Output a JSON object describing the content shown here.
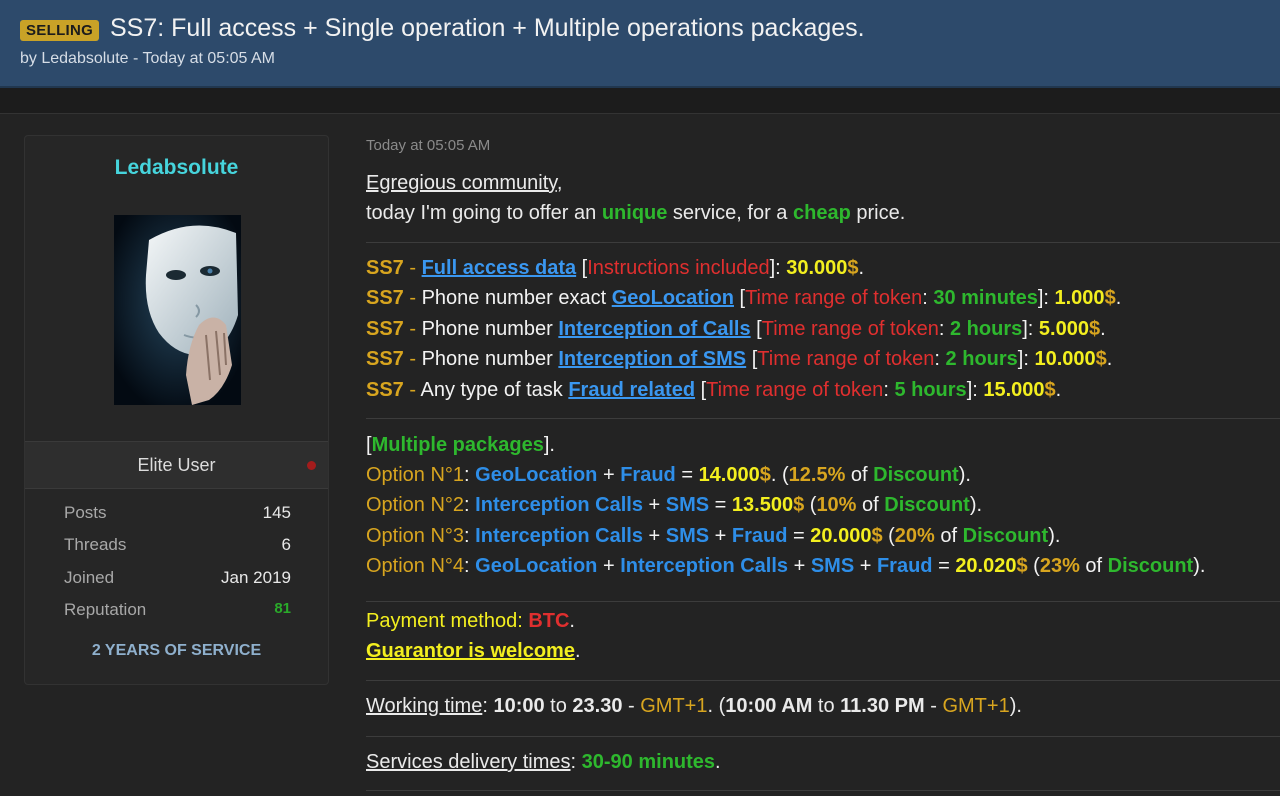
{
  "thread": {
    "badge": "SELLING",
    "title": "SS7: Full access + Single operation + Multiple operations packages.",
    "byline": "by Ledabsolute - Today at 05:05 AM"
  },
  "user": {
    "name": "Ledabsolute",
    "rank": "Elite User",
    "stats": [
      {
        "label": "Posts",
        "value": "145"
      },
      {
        "label": "Threads",
        "value": "6"
      },
      {
        "label": "Joined",
        "value": "Jan 2019"
      },
      {
        "label": "Reputation",
        "value": "81"
      }
    ],
    "service": "2 YEARS OF SERVICE"
  },
  "post": {
    "date": "Today at 05:05 AM",
    "intro": {
      "greeting": "Egregious community",
      "comma": ",",
      "l2_a": "today I'm going to offer an ",
      "l2_unique": "unique",
      "l2_b": " service, for a ",
      "l2_cheap": "cheap",
      "l2_c": " price."
    },
    "offers": [
      {
        "ss7": "SS7",
        "dash": " - ",
        "pre": "",
        "link": "Full access data",
        "br_open": " [",
        "token_label": "Instructions included",
        "colon": "",
        "token_value": "",
        "br_close": "]: ",
        "price": "30.000",
        "dollar": "$",
        "end": "."
      },
      {
        "ss7": "SS7",
        "dash": " - ",
        "pre": "Phone number exact ",
        "link": "GeoLocation",
        "br_open": " [",
        "token_label": "Time range of token",
        "colon": ": ",
        "token_value": "30 minutes",
        "br_close": "]: ",
        "price": "1.000",
        "dollar": "$",
        "end": "."
      },
      {
        "ss7": "SS7",
        "dash": " - ",
        "pre": "Phone number ",
        "link": "Interception of Calls",
        "br_open": " [",
        "token_label": "Time range of token",
        "colon": ": ",
        "token_value": "2 hours",
        "br_close": "]: ",
        "price": "5.000",
        "dollar": "$",
        "end": "."
      },
      {
        "ss7": "SS7",
        "dash": " - ",
        "pre": "Phone number ",
        "link": "Interception of SMS",
        "br_open": " [",
        "token_label": "Time range of token",
        "colon": ": ",
        "token_value": "2 hours",
        "br_close": "]: ",
        "price": "10.000",
        "dollar": "$",
        "end": "."
      },
      {
        "ss7": "SS7",
        "dash": " - ",
        "pre": "Any type of task ",
        "link": "Fraud related",
        "br_open": " [",
        "token_label": "Time range of token",
        "colon": ": ",
        "token_value": "5 hours",
        "br_close": "]: ",
        "price": "15.000",
        "dollar": "$",
        "end": "."
      }
    ],
    "packages": {
      "br_open": "[",
      "heading": "Multiple packages",
      "br_close": "].",
      "options": [
        {
          "label": "Option N°1",
          "sep": ": ",
          "items": [
            {
              "t": "GeoLocation",
              "c": "blue"
            },
            {
              "t": " + ",
              "c": "white"
            },
            {
              "t": "Fraud",
              "c": "blue"
            }
          ],
          "eq": " = ",
          "price": "14.000",
          "dollar": "$",
          "mid": ". (",
          "pct": "12.5%",
          "of": " of ",
          "disc": "Discount",
          "end": ")."
        },
        {
          "label": "Option N°2",
          "sep": ": ",
          "items": [
            {
              "t": "Interception Calls",
              "c": "blue"
            },
            {
              "t": " + ",
              "c": "white"
            },
            {
              "t": "SMS",
              "c": "blue"
            }
          ],
          "eq": " = ",
          "price": "13.500",
          "dollar": "$",
          "mid": " (",
          "pct": "10%",
          "of": " of ",
          "disc": "Discount",
          "end": ")."
        },
        {
          "label": "Option N°3",
          "sep": ": ",
          "items": [
            {
              "t": "Interception Calls",
              "c": "blue"
            },
            {
              "t": " + ",
              "c": "white"
            },
            {
              "t": "SMS",
              "c": "blue"
            },
            {
              "t": " + ",
              "c": "white"
            },
            {
              "t": "Fraud",
              "c": "blue"
            }
          ],
          "eq": " = ",
          "price": "20.000",
          "dollar": "$",
          "mid": " (",
          "pct": "20%",
          "of": " of ",
          "disc": "Discount",
          "end": ")."
        },
        {
          "label": "Option N°4",
          "sep": ": ",
          "items": [
            {
              "t": "GeoLocation",
              "c": "blue"
            },
            {
              "t": " + ",
              "c": "white"
            },
            {
              "t": "Interception Calls",
              "c": "blue"
            },
            {
              "t": " + ",
              "c": "white"
            },
            {
              "t": "SMS",
              "c": "blue"
            },
            {
              "t": " + ",
              "c": "white"
            },
            {
              "t": "Fraud",
              "c": "blue"
            }
          ],
          "eq": " = ",
          "price": "20.020",
          "dollar": "$",
          "mid": " (",
          "pct": "23%",
          "of": " of ",
          "disc": "Discount",
          "end": ")."
        }
      ]
    },
    "payment": {
      "label": "Payment method: ",
      "method": "BTC",
      "end": ".",
      "guarantor": "Guarantor is welcome",
      "guarantor_end": "."
    },
    "working": {
      "label": "Working time",
      "colon": ": ",
      "from": "10:00",
      "to_word": " to ",
      "to": "23.30",
      "dash": " - ",
      "tz": "GMT+1",
      "mid": ". (",
      "from12": "10:00 AM",
      "to_word2": " to ",
      "to12": "11.30 PM",
      "dash2": " - ",
      "tz2": "GMT+1",
      "end": ")."
    },
    "delivery": {
      "label": "Services delivery times",
      "colon": ": ",
      "value": "30-90 minutes",
      "end": "."
    }
  },
  "colors": {
    "header_bg": "#2d4a6b",
    "badge_bg": "#c9a227",
    "username": "#46d4dc",
    "green": "#2eb82e",
    "gold": "#d8a51f",
    "red": "#e02f2f",
    "blue": "#2e8ee8",
    "yellow": "#f3ef1f"
  }
}
